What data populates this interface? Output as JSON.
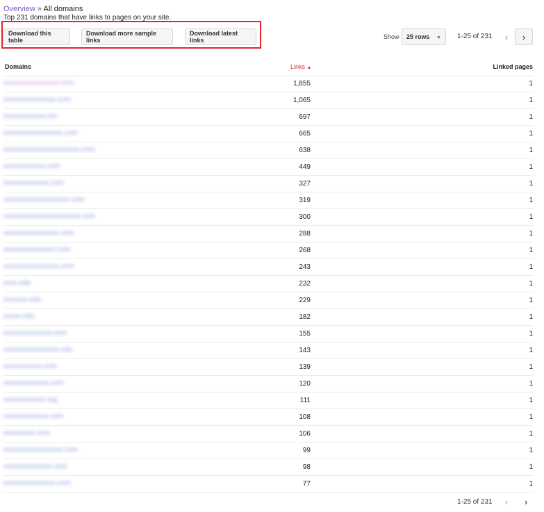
{
  "breadcrumb": {
    "overview": "Overview",
    "separator": "»",
    "current": "All domains"
  },
  "subtitle": "Top 231 domains that have links to pages on your site.",
  "toolbar": {
    "download_table": "Download this table",
    "download_sample": "Download more sample links",
    "download_latest": "Download latest links",
    "show_label": "Show",
    "rows_value": "25 rows"
  },
  "pagination": {
    "range": "1-25 of 231"
  },
  "icons": {
    "prev": "chevron-left-icon",
    "next": "chevron-right-icon",
    "caret": "caret-down-icon",
    "sort": "sort-up-icon"
  },
  "colors": {
    "link": "#6a83d8",
    "visited": "#b07ad6",
    "sort_active": "#d23f31",
    "highlight": "#e0232d"
  },
  "table": {
    "headers": {
      "domains": "Domains",
      "links": "Links",
      "linked_pages": "Linked pages"
    },
    "rows": [
      {
        "domain": "xxxxxxxxxxxxxxxx.com",
        "links": "1,855",
        "linked": "1"
      },
      {
        "domain": "xxxxxxxxxxxxxxx.com",
        "links": "1,065",
        "linked": "1"
      },
      {
        "domain": "xxxxxxxxxxxx.net",
        "links": "697",
        "linked": "1"
      },
      {
        "domain": "xxxxxxxxxxxxxxxxx.com",
        "links": "665",
        "linked": "1"
      },
      {
        "domain": "xxxxxxxxxxxxxxxxxxxxxx.com",
        "links": "638",
        "linked": "1"
      },
      {
        "domain": "xxxxxxxxxxxx.com",
        "links": "449",
        "linked": "1"
      },
      {
        "domain": "xxxxxxxxxxxxx.com",
        "links": "327",
        "linked": "1"
      },
      {
        "domain": "xxxxxxxxxxxxxxxxxxx.com",
        "links": "319",
        "linked": "1"
      },
      {
        "domain": "xxxxxxxxxxxxxxxxxxxxxx.com",
        "links": "300",
        "linked": "1"
      },
      {
        "domain": "xxxxxxxxxxxxxxxx.com",
        "links": "288",
        "linked": "1"
      },
      {
        "domain": "xxxxxxxxxxxxxxx.com",
        "links": "268",
        "linked": "1"
      },
      {
        "domain": "xxxxxxxxxxxxxxxx.com",
        "links": "243",
        "linked": "1"
      },
      {
        "domain": "xxxx.edu",
        "links": "232",
        "linked": "1"
      },
      {
        "domain": "xxxxxxx.edu",
        "links": "229",
        "linked": "1"
      },
      {
        "domain": "xxxxx.edu",
        "links": "182",
        "linked": "1"
      },
      {
        "domain": "xxxxxxxxxxxxxx.com",
        "links": "155",
        "linked": "1"
      },
      {
        "domain": "xxxxxxxxxxxxxxxx.edu",
        "links": "143",
        "linked": "1"
      },
      {
        "domain": "xxxxxxxxxxx.com",
        "links": "139",
        "linked": "1"
      },
      {
        "domain": "xxxxxxxxxxxxx.com",
        "links": "120",
        "linked": "1"
      },
      {
        "domain": "xxxxxxxxxxxx.org",
        "links": "111",
        "linked": "1"
      },
      {
        "domain": "xxxxxxxxxxxxx.com",
        "links": "108",
        "linked": "1"
      },
      {
        "domain": "xxxxxxxxx.com",
        "links": "106",
        "linked": "1"
      },
      {
        "domain": "xxxxxxxxxxxxxxxxx.com",
        "links": "99",
        "linked": "1"
      },
      {
        "domain": "xxxxxxxxxxxxxx.com",
        "links": "98",
        "linked": "1"
      },
      {
        "domain": "xxxxxxxxxxxxxxx.com",
        "links": "77",
        "linked": "1"
      }
    ]
  }
}
